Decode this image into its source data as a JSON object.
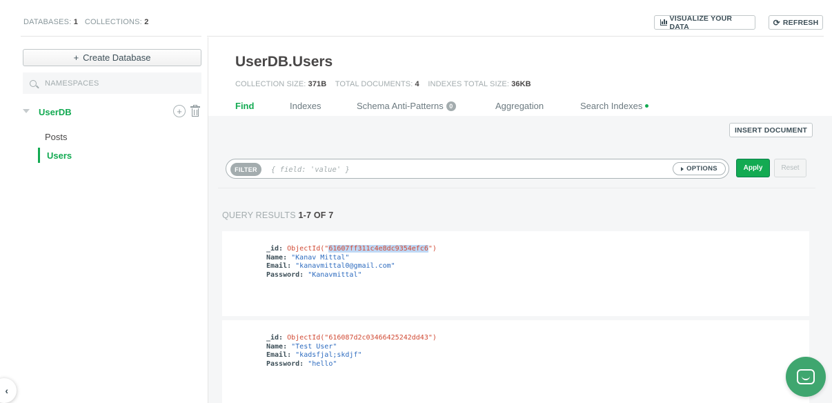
{
  "header": {
    "databases_label": "DATABASES:",
    "databases_count": "1",
    "collections_label": "COLLECTIONS:",
    "collections_count": "2",
    "visualize_label": "VISUALIZE YOUR DATA",
    "refresh_label": "REFRESH"
  },
  "sidebar": {
    "create_db_label": "Create Database",
    "namespaces_placeholder": "NAMESPACES",
    "database": "UserDB",
    "collections": [
      {
        "label": "Posts"
      },
      {
        "label": "Users"
      }
    ]
  },
  "main": {
    "title": "UserDB.Users",
    "stats": {
      "size_label": "COLLECTION SIZE:",
      "size_value": "371B",
      "docs_label": "TOTAL DOCUMENTS:",
      "docs_value": "4",
      "indexes_label": "INDEXES TOTAL SIZE:",
      "indexes_value": "36KB"
    },
    "tabs": [
      {
        "label": "Find"
      },
      {
        "label": "Indexes"
      },
      {
        "label": "Schema Anti-Patterns",
        "badge": "0"
      },
      {
        "label": "Aggregation"
      },
      {
        "label": "Search Indexes"
      }
    ],
    "insert_label": "INSERT DOCUMENT",
    "filter": {
      "pill": "FILTER",
      "placeholder": "{ field: 'value' }",
      "options_label": "OPTIONS",
      "apply_label": "Apply",
      "reset_label": "Reset"
    },
    "results": {
      "label": "QUERY RESULTS",
      "range": "1-7 OF 7"
    },
    "documents": [
      {
        "id_prefix": "ObjectId(\"",
        "id_value": "61607ff311c4e8dc9354efc6",
        "id_suffix": "\")",
        "name": "\"Kanav Mittal\"",
        "email": "\"kanavmittal0@gmail.com\"",
        "password": "\"Kanavmittal\""
      },
      {
        "id_prefix": "ObjectId(\"",
        "id_value": "616087d2c03466425242dd43",
        "id_suffix": "\")",
        "name": "\"Test User\"",
        "email": "\"kadsfjal;skdjf\"",
        "password": "\"hello\""
      }
    ],
    "field_labels": {
      "id": "_id:",
      "name": "Name:",
      "email": "Email:",
      "password": "Password:"
    }
  },
  "colors": {
    "accent": "#13aa52",
    "chat": "#3fa66f"
  }
}
